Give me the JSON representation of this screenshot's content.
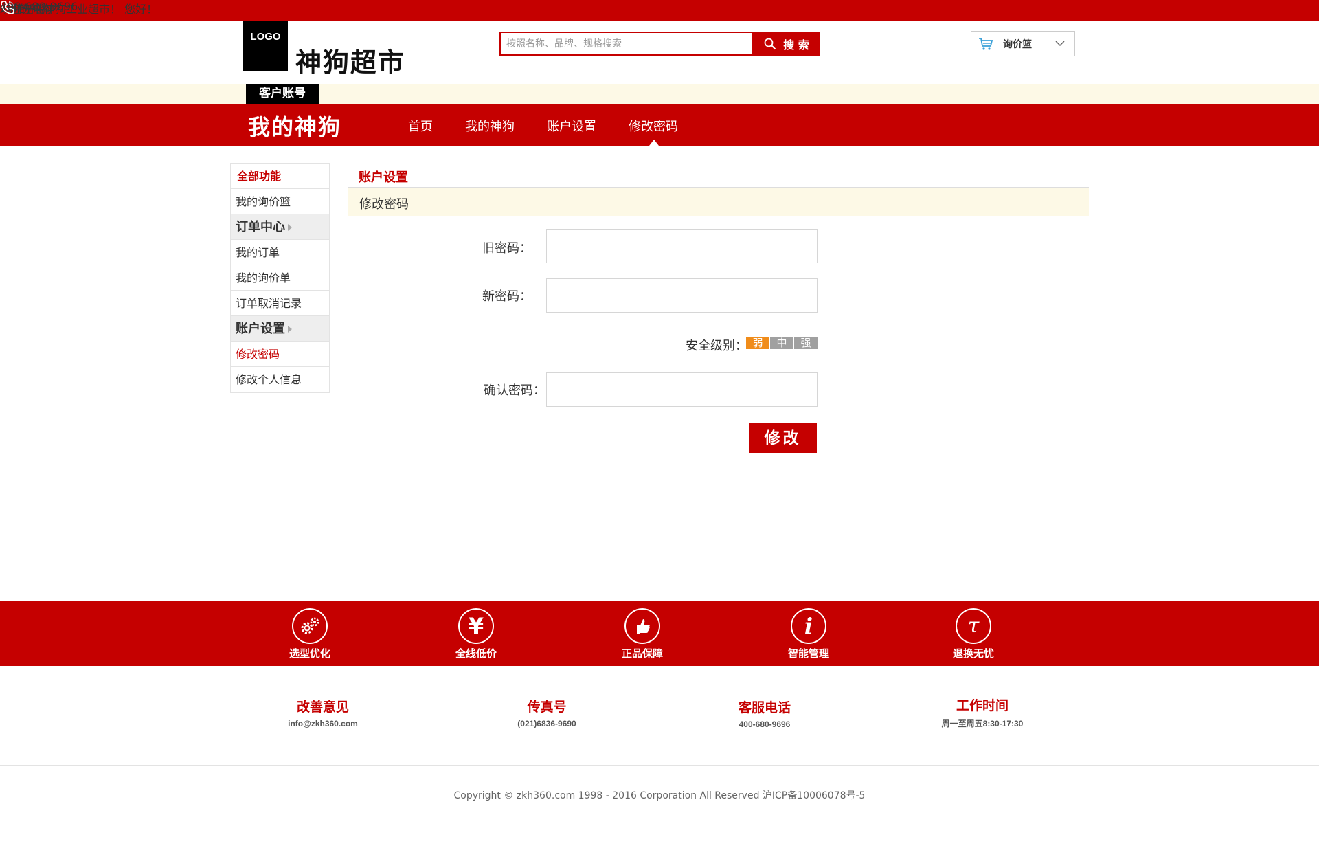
{
  "topbar": {
    "welcome": "欢迎光临神狗工业超市！  您好！",
    "my_link": "› 我的神狗",
    "phone": "400-680-9696"
  },
  "header": {
    "logo_text": "LOGO",
    "site_name": "神狗超市",
    "search_placeholder": "按照名称、品牌、规格搜索",
    "search_button": "搜 索",
    "cart_label": "询价篮"
  },
  "account_tab": "客户账号",
  "nav": {
    "title": "我的神狗",
    "items": [
      "首页",
      "我的神狗",
      "账户设置",
      "修改密码"
    ],
    "active_index": 3
  },
  "sidebar": {
    "head": "全部功能",
    "items": [
      {
        "label": "我的询价篮",
        "type": "item"
      },
      {
        "label": "订单中心",
        "type": "group"
      },
      {
        "label": "我的订单",
        "type": "item"
      },
      {
        "label": "我的询价单",
        "type": "item"
      },
      {
        "label": "订单取消记录",
        "type": "item"
      },
      {
        "label": "账户设置",
        "type": "group"
      },
      {
        "label": "修改密码",
        "type": "active"
      },
      {
        "label": "修改个人信息",
        "type": "item"
      }
    ]
  },
  "main": {
    "section_title": "账户设置",
    "sub_title": "修改密码",
    "old_password_label": "旧密码：",
    "new_password_label": "新密码：",
    "strength_label": "安全级别：",
    "strength_levels": [
      "弱",
      "中",
      "强"
    ],
    "confirm_label": "确认密码：",
    "submit": "修改"
  },
  "features": [
    {
      "label": "选型优化",
      "icon": "gears-icon"
    },
    {
      "label": "全线低价",
      "icon": "yen-icon"
    },
    {
      "label": "正品保障",
      "icon": "thumbs-up-icon"
    },
    {
      "label": "智能管理",
      "icon": "info-icon"
    },
    {
      "label": "退换无忧",
      "icon": "return-icon"
    }
  ],
  "contacts": [
    {
      "title": "改善意见",
      "value": "info@zkh360.com"
    },
    {
      "title": "传真号",
      "value": "(021)6836-9690"
    },
    {
      "title": "客服电话",
      "value": "400-680-9696"
    },
    {
      "title": "工作时间",
      "value": "周一至周五8:30-17:30"
    }
  ],
  "copyright": "Copyright © zkh360.com 1998 - 2016 Corporation All Reserved 沪ICP备10006078号-5",
  "colors": {
    "brand_red": "#c50000",
    "cream": "#fdf9e6",
    "weak": "#f08c1a",
    "gray_level": "#a0a0a0"
  }
}
